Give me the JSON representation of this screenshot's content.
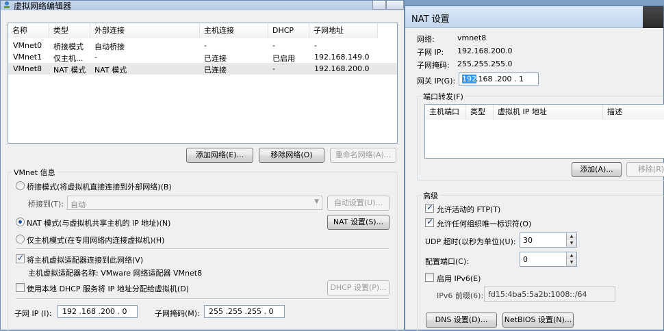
{
  "left_window": {
    "title": "虚拟网络编辑器",
    "table": {
      "headers": [
        "名称",
        "类型",
        "外部连接",
        "主机连接",
        "DHCP",
        "子网地址"
      ],
      "rows": [
        [
          "VMnet0",
          "桥接模式",
          "自动桥接",
          "-",
          "-",
          "-"
        ],
        [
          "VMnet1",
          "仅主机...",
          "-",
          "已连接",
          "已启用",
          "192.168.149.0"
        ],
        [
          "VMnet8",
          "NAT 模式",
          "NAT 模式",
          "已连接",
          "-",
          "192.168.200.0"
        ]
      ]
    },
    "buttons": {
      "add_network": "添加网络(E)...",
      "remove_network": "移除网络(O)",
      "rename_network": "重命名网络(A)..."
    },
    "vmnet_info": {
      "group_title": "VMnet 信息",
      "bridged_label": "桥接模式(将虚拟机直接连接到外部网络)(B)",
      "bridge_to_label": "桥接到(T):",
      "bridge_to_value": "自动",
      "auto_settings": "自动设置(U)...",
      "nat_label": "NAT 模式(与虚拟机共享主机的 IP 地址)(N)",
      "nat_settings": "NAT 设置(S)...",
      "hostonly_label": "仅主机模式(在专用网络内连接虚拟机)(H)",
      "connect_adapter_label": "将主机虚拟适配器连接到此网络(V)",
      "adapter_name": "主机虚拟适配器名称: VMware 网络适配器 VMnet8",
      "dhcp_label": "使用本地 DHCP 服务将 IP 地址分配给虚拟机(D)",
      "dhcp_settings": "DHCP 设置(P)...",
      "subnet_ip_label": "子网 IP (I):",
      "subnet_ip_value": "192 .168 .200 . 0",
      "subnet_mask_label": "子网掩码(M):",
      "subnet_mask_value": "255 .255 .255 . 0"
    }
  },
  "right_window": {
    "title": "NAT 设置",
    "network_label": "网络:",
    "network_value": "vmnet8",
    "subnet_ip_label": "子网 IP:",
    "subnet_ip_value": "192.168.200.0",
    "subnet_mask_label": "子网掩码:",
    "subnet_mask_value": "255.255.255.0",
    "gateway_label": "网关 IP(G):",
    "gateway_first": "192",
    "gateway_rest": " .168 .200 . 1",
    "port_forward": {
      "title": "端口转发(F)",
      "headers": [
        "主机端口",
        "类型",
        "虚拟机 IP 地址",
        "描述"
      ],
      "add": "添加(A)...",
      "remove": "移除(R)"
    },
    "advanced": {
      "title": "高级",
      "allow_ftp": "允许活动的 FTP(T)",
      "allow_oui": "允许任何组织唯一标识符(O)",
      "udp_timeout_label": "UDP 超时(以秒为单位)(U):",
      "udp_timeout_value": "30",
      "config_port_label": "配置端口(C):",
      "config_port_value": "0",
      "enable_ipv6": "启用 IPv6(E)",
      "ipv6_prefix_label": "IPv6 前缀(6):",
      "ipv6_prefix_value": "fd15:4ba5:5a2b:1008::/64"
    },
    "buttons": {
      "dns": "DNS 设置(D)...",
      "netbios": "NetBIOS 设置(N)..."
    }
  }
}
